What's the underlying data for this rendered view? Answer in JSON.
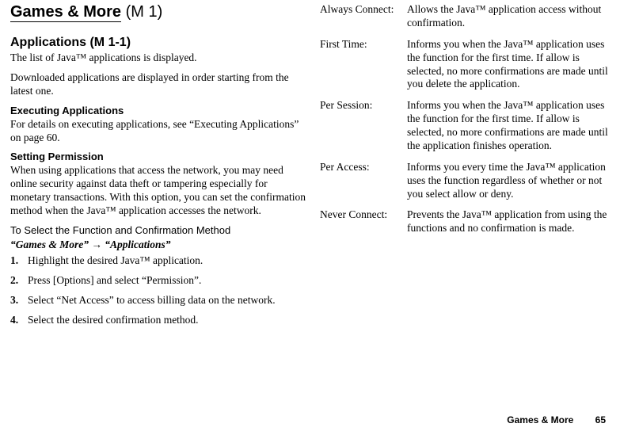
{
  "chapter": {
    "title": "Games & More",
    "tag": "(M 1)"
  },
  "section": {
    "title": "Applications",
    "tag": "(M 1-1)",
    "intro1": "The list of Java™ applications is displayed.",
    "intro2": "Downloaded applications are displayed in order starting from the latest one."
  },
  "executing": {
    "heading": "Executing Applications",
    "body": "For details on executing applications, see “Executing Applications” on page 60."
  },
  "permission": {
    "heading": "Setting Permission",
    "body": "When using applications that access the network, you may need online security against data theft or tampering especially for monetary transactions. With this option, you can set the confirmation method when the Java™ application accesses the network."
  },
  "select_fn": {
    "heading": "To Select the Function and Confirmation Method",
    "path_a": "“Games & More”",
    "path_b": "“Applications”"
  },
  "steps": [
    "Highlight the desired Java™ application.",
    "Press [Options] and select “Permission”.",
    "Select “Net Access” to access billing data on the network.",
    "Select the desired confirmation method."
  ],
  "modes": [
    {
      "term": "Always Connect:",
      "desc": "Allows the Java™ application access without confirmation."
    },
    {
      "term": "First Time:",
      "desc": "Informs you when the Java™ application uses the function for the first time. If allow is selected, no more confirmations are made until you delete the application."
    },
    {
      "term": "Per Session:",
      "desc": "Informs you when the Java™ application uses the function for the first time. If allow is selected, no more confirmations are made until the application finishes operation."
    },
    {
      "term": "Per Access:",
      "desc": "Informs you every time the Java™ application uses the function regardless of whether or not you select allow or deny."
    },
    {
      "term": "Never Connect:",
      "desc": "Prevents the Java™ application from using the functions and no confirmation is made."
    }
  ],
  "footer": {
    "label": "Games & More",
    "page": "65"
  }
}
